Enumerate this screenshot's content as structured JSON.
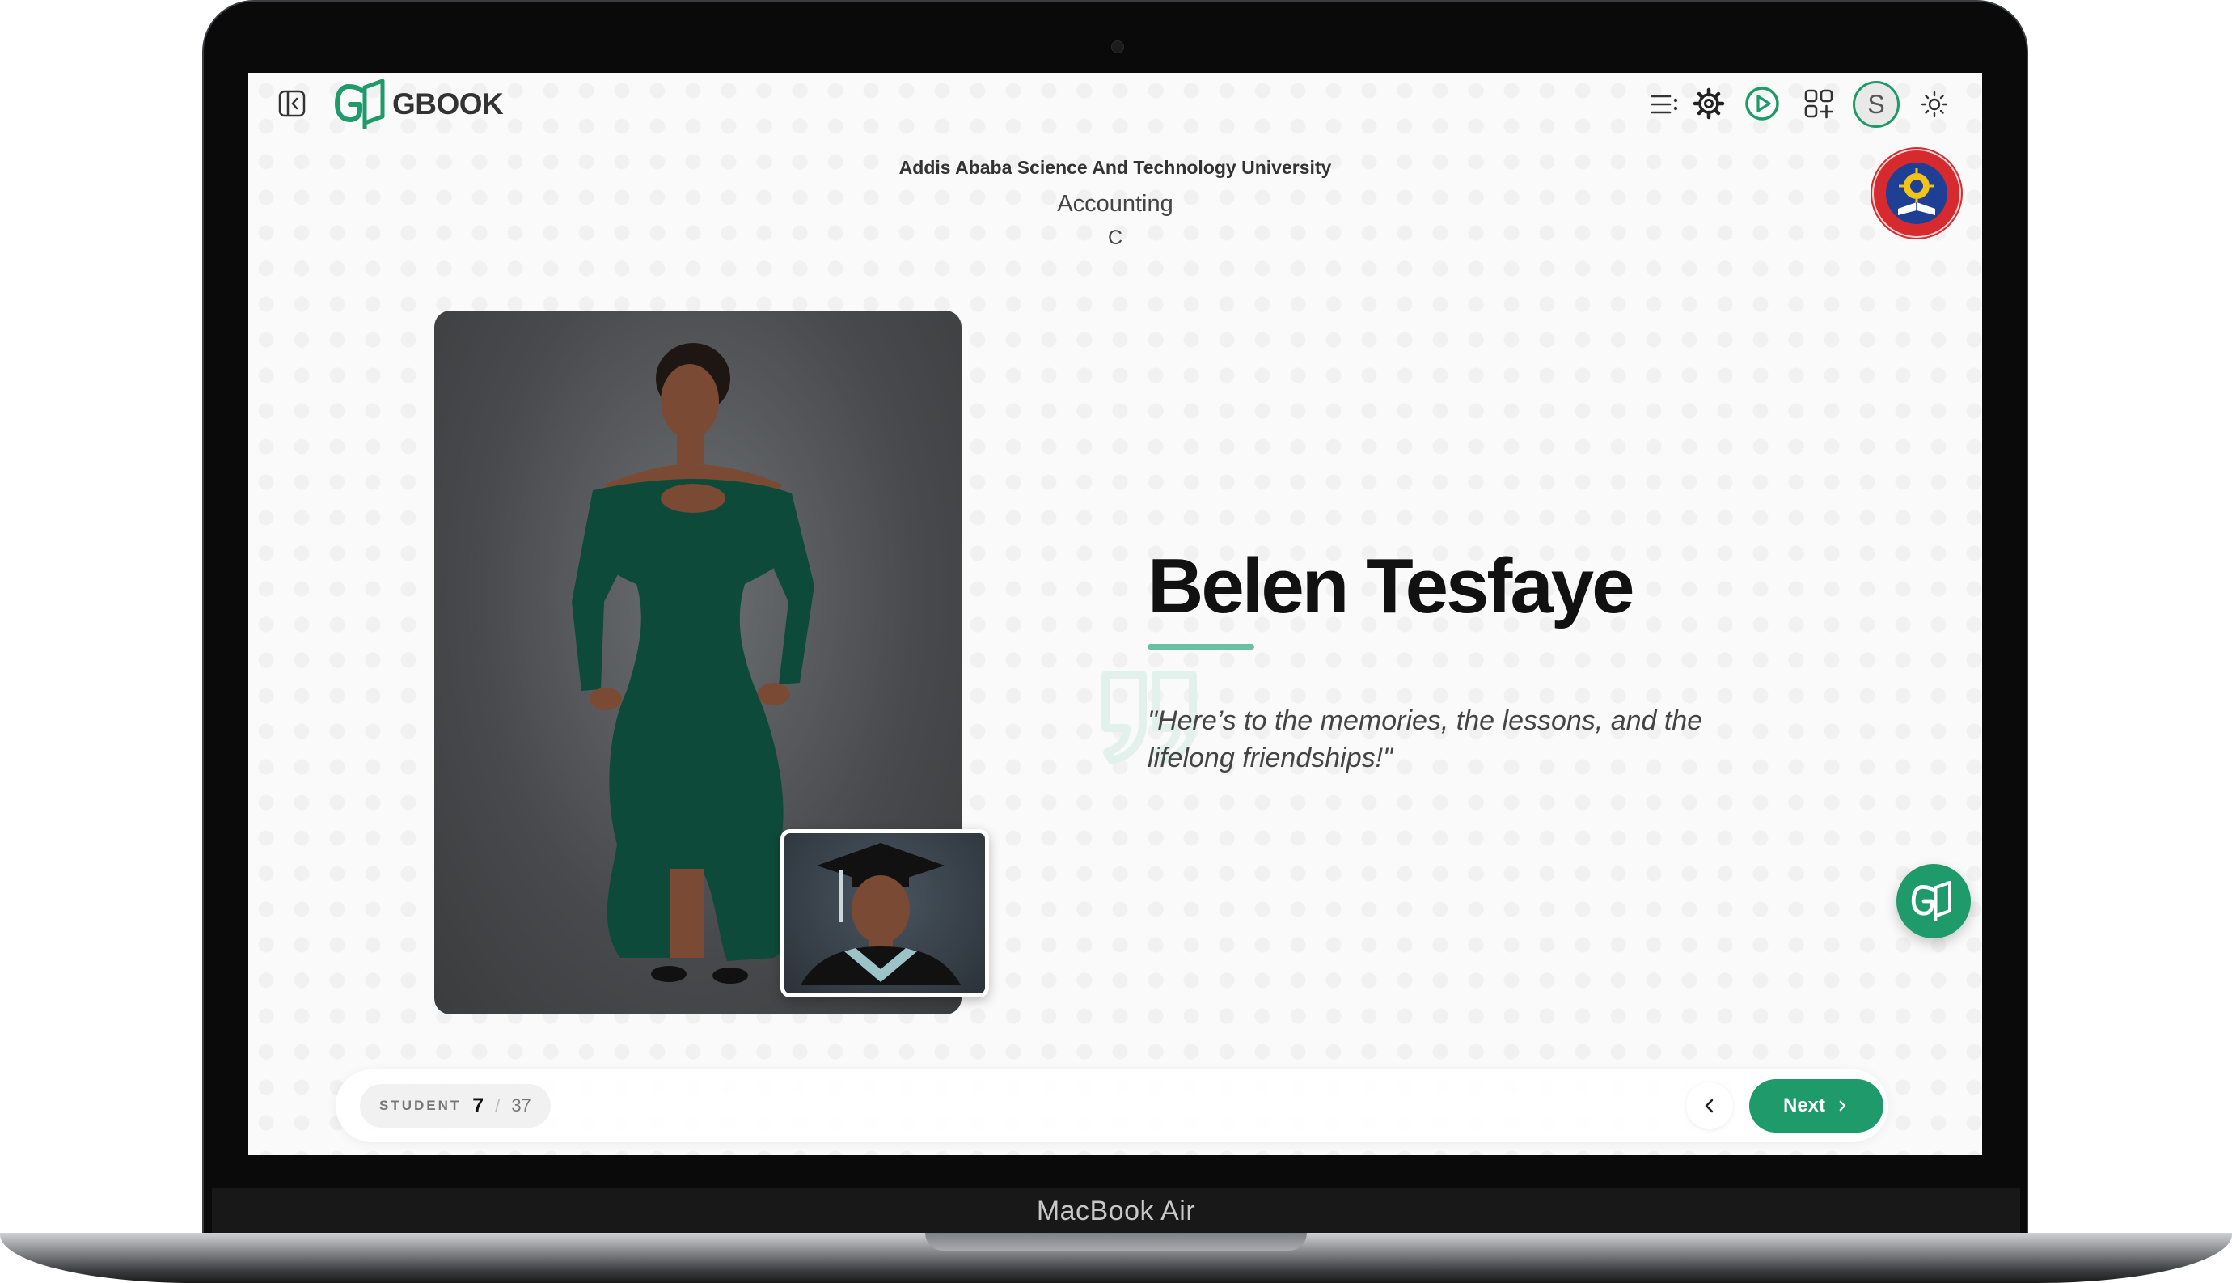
{
  "device": {
    "model_label": "MacBook Air"
  },
  "header": {
    "logo_text": "GBOOK",
    "avatar_initial": "S"
  },
  "institution": {
    "university": "Addis Ababa Science And Technology University",
    "department": "Accounting",
    "section": "C"
  },
  "profile": {
    "name": "Belen Tesfaye",
    "quote": "\"Here’s to the memories, the lessons, and the lifelong friendships!\""
  },
  "pagination": {
    "label": "STUDENT",
    "current": "7",
    "separator": "/",
    "total": "37",
    "next_label": "Next"
  },
  "colors": {
    "accent": "#1f9a6a",
    "accent_light": "#6ac0a1",
    "text_dark": "#111111",
    "seal_red": "#d62a2e",
    "seal_blue": "#1f3f95",
    "seal_gold": "#f2c318"
  }
}
